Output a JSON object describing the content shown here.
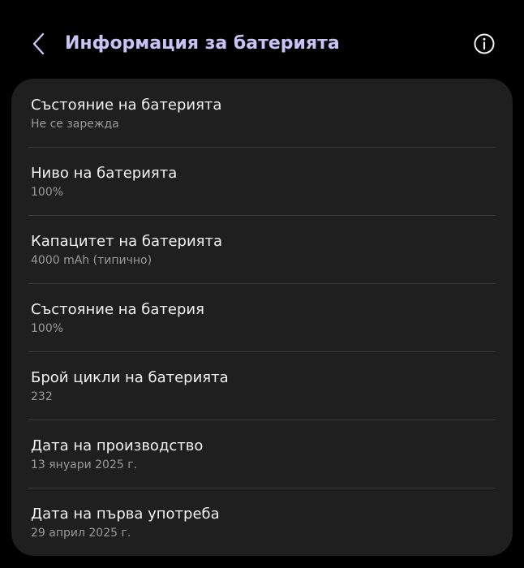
{
  "header": {
    "title": "Информация за батерията",
    "back_icon": "chevron-left-icon",
    "info_icon": "info-circle-icon",
    "title_color": "#c9c2f5"
  },
  "items": [
    {
      "title": "Състояние на батерията",
      "subtitle": "Не се зарежда"
    },
    {
      "title": "Ниво на батерията",
      "subtitle": "100%"
    },
    {
      "title": "Капацитет на батерията",
      "subtitle": "4000 mAh (типично)"
    },
    {
      "title": "Състояние на батерия",
      "subtitle": "100%"
    },
    {
      "title": "Брой цикли на батерията",
      "subtitle": "232"
    },
    {
      "title": "Дата на производство",
      "subtitle": "13 януари 2025 г."
    },
    {
      "title": "Дата на първа употреба",
      "subtitle": "29 април 2025 г."
    }
  ]
}
